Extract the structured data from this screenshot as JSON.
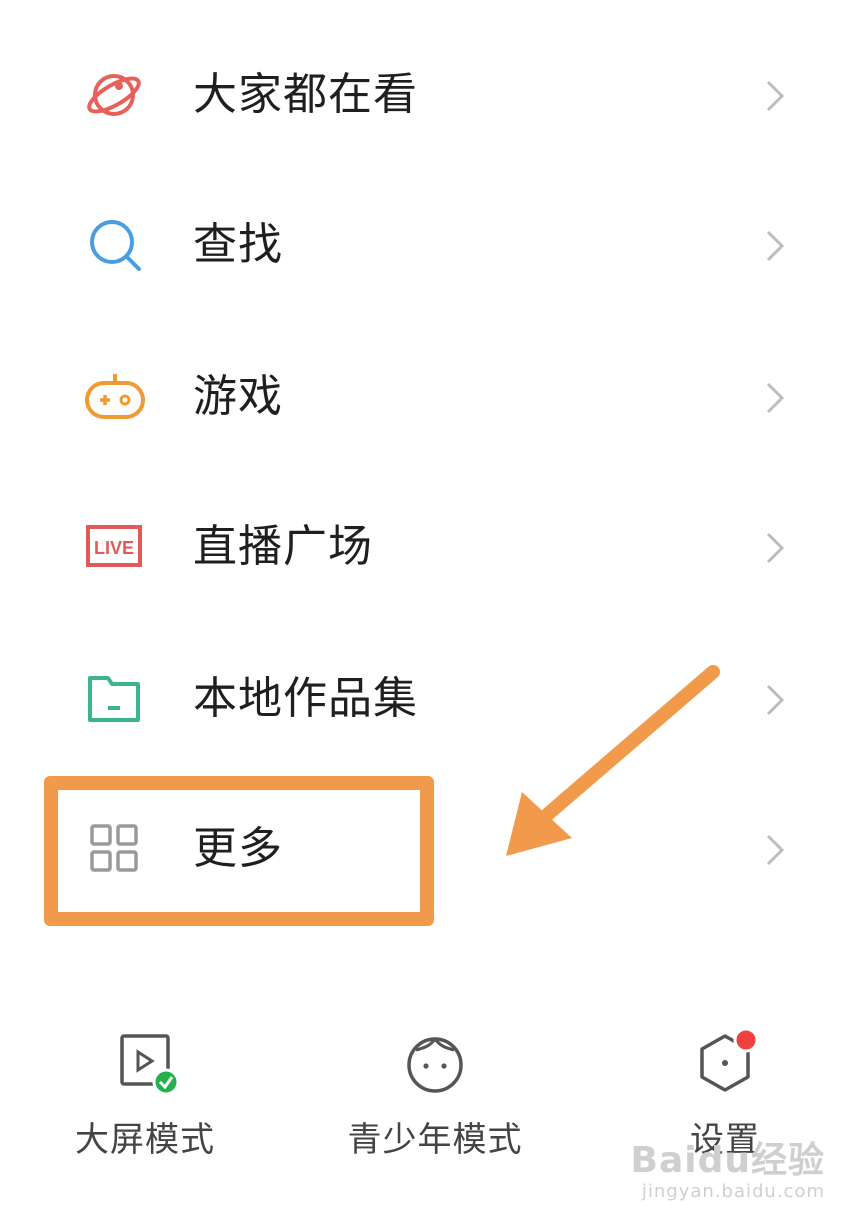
{
  "menu": {
    "items": [
      {
        "label": "大家都在看",
        "icon": "planet-icon"
      },
      {
        "label": "查找",
        "icon": "search-icon"
      },
      {
        "label": "游戏",
        "icon": "gamepad-icon"
      },
      {
        "label": "直播广场",
        "icon": "live-icon",
        "icon_text": "LIVE"
      },
      {
        "label": "本地作品集",
        "icon": "folder-icon"
      },
      {
        "label": "更多",
        "icon": "grid-icon"
      }
    ]
  },
  "bottom": {
    "items": [
      {
        "label": "大屏模式",
        "icon": "screen-play-icon"
      },
      {
        "label": "青少年模式",
        "icon": "child-face-icon"
      },
      {
        "label": "设置",
        "icon": "hexagon-settings-icon",
        "badge": true
      }
    ]
  },
  "watermark": {
    "brand": "Baidu经验",
    "url": "jingyan.baidu.com"
  },
  "colors": {
    "planet": "#e8605a",
    "search": "#4a9ee0",
    "gamepad": "#ef9a33",
    "live": "#e05a5a",
    "folder": "#3cb48c",
    "grid": "#9a9a9a",
    "highlight": "#f29a4b",
    "badge": "#f04040",
    "check": "#22b14c"
  }
}
